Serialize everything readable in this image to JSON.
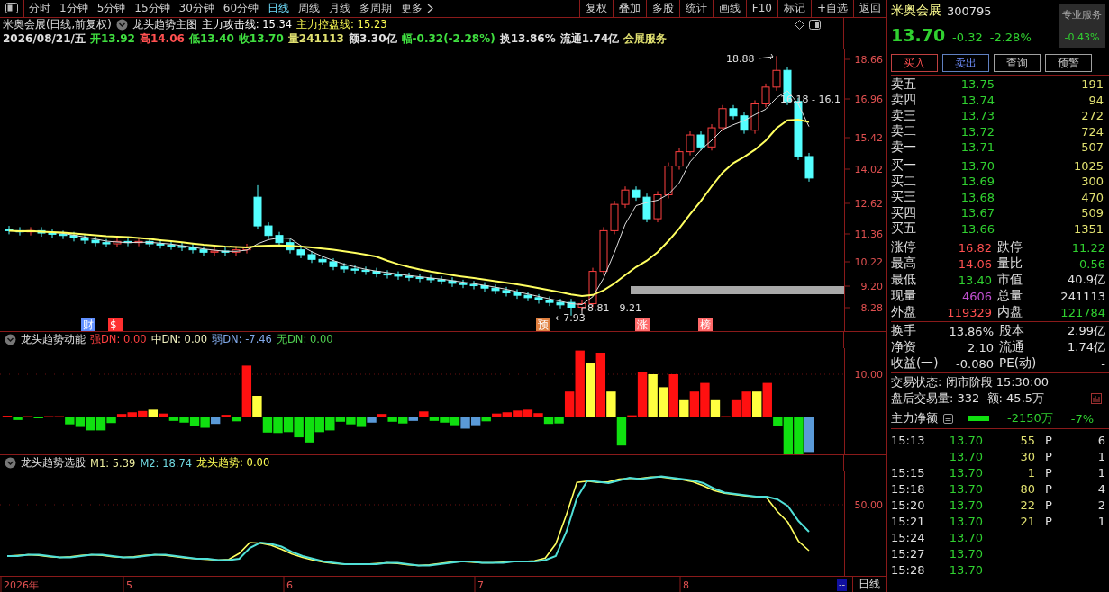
{
  "toolbar": {
    "periods": [
      {
        "label": "分时",
        "selected": false
      },
      {
        "label": "1分钟",
        "selected": false
      },
      {
        "label": "5分钟",
        "selected": false
      },
      {
        "label": "15分钟",
        "selected": false
      },
      {
        "label": "30分钟",
        "selected": false
      },
      {
        "label": "60分钟",
        "selected": false
      },
      {
        "label": "日线",
        "selected": true
      },
      {
        "label": "周线",
        "selected": false
      },
      {
        "label": "月线",
        "selected": false
      },
      {
        "label": "多周期",
        "selected": false
      }
    ],
    "more": "更多",
    "actions": [
      "复权",
      "叠加",
      "多股",
      "统计",
      "画线",
      "F10",
      "标记",
      "+自选",
      "返回"
    ]
  },
  "main_chart": {
    "title": "米奥会展(日线,前复权)",
    "indicator": "龙头趋势主图",
    "lines": [
      {
        "label": "主力攻击线: 15.34",
        "color": "#ffffff"
      },
      {
        "label": "主力控盘线: 15.23",
        "color": "#ffff54"
      }
    ],
    "quote": [
      {
        "text": "2026/08/21/五",
        "color": "#e0e0e0"
      },
      {
        "text": "开13.92",
        "color": "#40e040"
      },
      {
        "text": "高14.06",
        "color": "#ff5050"
      },
      {
        "text": "低13.40",
        "color": "#40e040"
      },
      {
        "text": "收13.70",
        "color": "#40e040"
      },
      {
        "text": "量241113",
        "color": "#e0e070"
      },
      {
        "text": "额3.30亿",
        "color": "#e0e0e0"
      },
      {
        "text": "幅-0.32(-2.28%)",
        "color": "#40e040"
      },
      {
        "text": "换13.86%",
        "color": "#e0e0e0"
      },
      {
        "text": "流通1.74亿",
        "color": "#e0e0e0"
      },
      {
        "text": "会展服务",
        "color": "#e0e070"
      }
    ],
    "y_ticks": [
      "18.66",
      "16.96",
      "15.42",
      "14.02",
      "12.62",
      "11.36",
      "10.22",
      "9.20",
      "8.28"
    ],
    "annotations": [
      {
        "text": "18.88"
      },
      {
        "text": "16.18 - 16.1"
      },
      {
        "text": "8.81 - 9.21"
      },
      {
        "text": "←7.93"
      }
    ],
    "markers": [
      {
        "text": "财",
        "color": "#6090ff"
      },
      {
        "text": "$",
        "color": "#ff3030"
      },
      {
        "text": "预",
        "color": "#e08040"
      },
      {
        "text": "涨",
        "color": "#ff6a6a"
      },
      {
        "text": "榜",
        "color": "#ff6a6a"
      }
    ]
  },
  "momentum": {
    "title": "龙头趋势动能",
    "values": [
      {
        "text": "强DN: 0.00",
        "color": "#ff4040"
      },
      {
        "text": "中DN: 0.00",
        "color": "#f0f0c0"
      },
      {
        "text": "弱DN: -7.46",
        "color": "#80a8e8"
      },
      {
        "text": "无DN: 0.00",
        "color": "#50d050"
      }
    ],
    "y_tick": "10.00"
  },
  "selection": {
    "title": "龙头趋势选股",
    "values": [
      {
        "text": "M1: 5.39",
        "color": "#f0f0a0"
      },
      {
        "text": "M2: 18.74",
        "color": "#70d8e0"
      },
      {
        "text": "龙头趋势: 0.00",
        "color": "#ffff54"
      }
    ],
    "y_tick": "50.00"
  },
  "date_axis": {
    "labels": [
      "2026年",
      "5",
      "6",
      "7",
      "8"
    ],
    "scroll": "--",
    "period": "日线"
  },
  "stock": {
    "name": "米奥会展",
    "code": "300795",
    "price": "13.70",
    "change": "-0.32",
    "pct": "-2.28%",
    "service": {
      "label": "专业服务",
      "value": "-0.43%"
    }
  },
  "trade_buttons": [
    {
      "label": "买入",
      "kind": "buy"
    },
    {
      "label": "卖出",
      "kind": "sell"
    },
    {
      "label": "查询",
      "kind": "plain"
    },
    {
      "label": "预警",
      "kind": "plain"
    }
  ],
  "asks": [
    {
      "label": "卖五",
      "price": "13.75",
      "volume": "191"
    },
    {
      "label": "卖四",
      "price": "13.74",
      "volume": "94"
    },
    {
      "label": "卖三",
      "price": "13.73",
      "volume": "272"
    },
    {
      "label": "卖二",
      "price": "13.72",
      "volume": "724"
    },
    {
      "label": "卖一",
      "price": "13.71",
      "volume": "507"
    }
  ],
  "bids": [
    {
      "label": "买一",
      "price": "13.70",
      "volume": "1025"
    },
    {
      "label": "买二",
      "price": "13.69",
      "volume": "300"
    },
    {
      "label": "买三",
      "price": "13.68",
      "volume": "470"
    },
    {
      "label": "买四",
      "price": "13.67",
      "volume": "509"
    },
    {
      "label": "买五",
      "price": "13.66",
      "volume": "1351"
    }
  ],
  "stats": [
    {
      "label": "涨停",
      "value": "16.82",
      "color": "#ff5050"
    },
    {
      "label": "跌停",
      "value": "11.22",
      "color": "#30d030"
    },
    {
      "label": "最高",
      "value": "14.06",
      "color": "#ff5050"
    },
    {
      "label": "量比",
      "value": "0.56",
      "color": "#30d030"
    },
    {
      "label": "最低",
      "value": "13.40",
      "color": "#30d030"
    },
    {
      "label": "市值",
      "value": "40.9亿",
      "color": "#e0e0e0"
    },
    {
      "label": "现量",
      "value": "4606",
      "color": "#c050d0"
    },
    {
      "label": "总量",
      "value": "241113",
      "color": "#e0e0e0"
    },
    {
      "label": "外盘",
      "value": "119329",
      "color": "#ff5050"
    },
    {
      "label": "内盘",
      "value": "121784",
      "color": "#30d030"
    }
  ],
  "fundamentals": [
    {
      "label": "换手",
      "value": "13.86%"
    },
    {
      "label": "股本",
      "value": "2.99亿"
    },
    {
      "label": "净资",
      "value": "2.10"
    },
    {
      "label": "流通",
      "value": "1.74亿"
    },
    {
      "label": "收益(一)",
      "value": "-0.080"
    },
    {
      "label": "PE(动)",
      "value": "-"
    }
  ],
  "status": {
    "state": "交易状态: 闭市阶段 15:30:00",
    "after_hours": "盘后交易量: 332  额: 45.5万"
  },
  "net_flow": {
    "label": "主力净额",
    "value": "-2150万",
    "pct": "-7%"
  },
  "ticks": [
    {
      "time": "15:13",
      "price": "13.70",
      "volume": "55",
      "flag": "P",
      "count": "6"
    },
    {
      "price": "13.70",
      "volume": "30",
      "flag": "P",
      "count": "1"
    },
    {
      "time": "15:15",
      "price": "13.70",
      "volume": "1",
      "flag": "P",
      "count": "1"
    },
    {
      "time": "15:18",
      "price": "13.70",
      "volume": "80",
      "flag": "P",
      "count": "4"
    },
    {
      "time": "15:20",
      "price": "13.70",
      "volume": "22",
      "flag": "P",
      "count": "2"
    },
    {
      "time": "15:21",
      "price": "13.70",
      "volume": "21",
      "flag": "P",
      "count": "1"
    },
    {
      "time": "15:24",
      "price": "13.70"
    },
    {
      "time": "15:27",
      "price": "13.70"
    },
    {
      "time": "15:28",
      "price": "13.70"
    }
  ]
}
